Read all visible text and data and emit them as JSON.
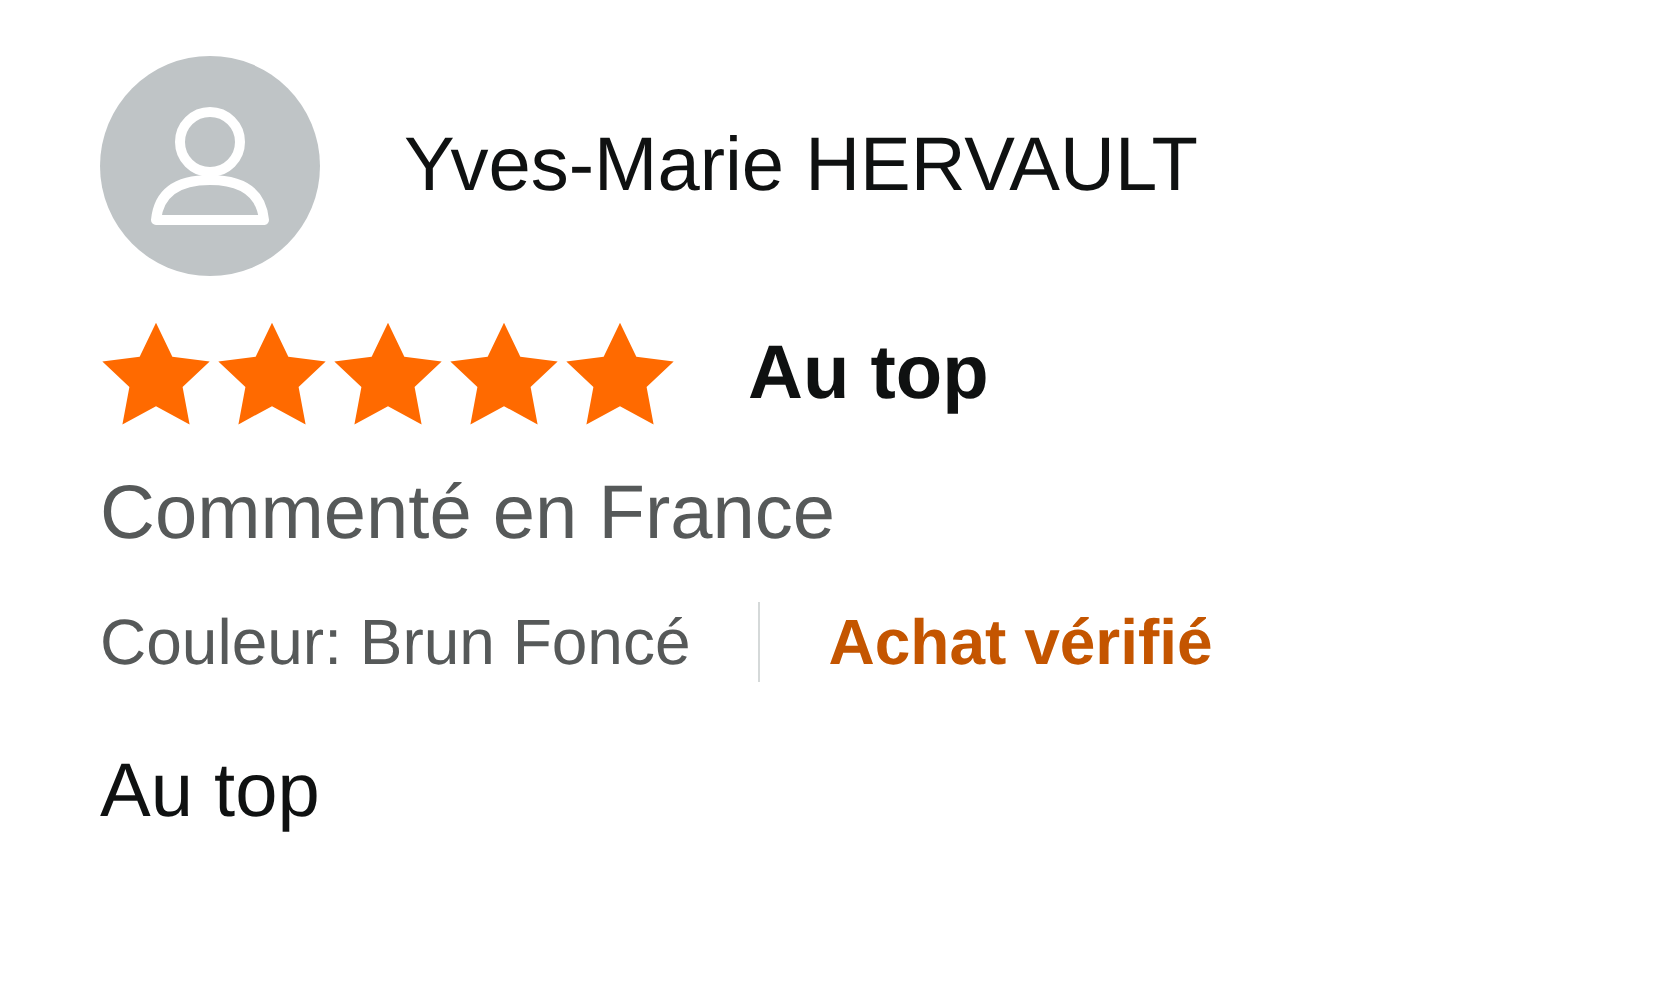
{
  "review": {
    "author": "Yves-Marie HERVAULT",
    "stars": 5,
    "title": "Au top",
    "location": "Commenté en France",
    "variant": "Couleur: Brun Foncé",
    "badge": "Achat vérifié",
    "body": "Au top"
  }
}
